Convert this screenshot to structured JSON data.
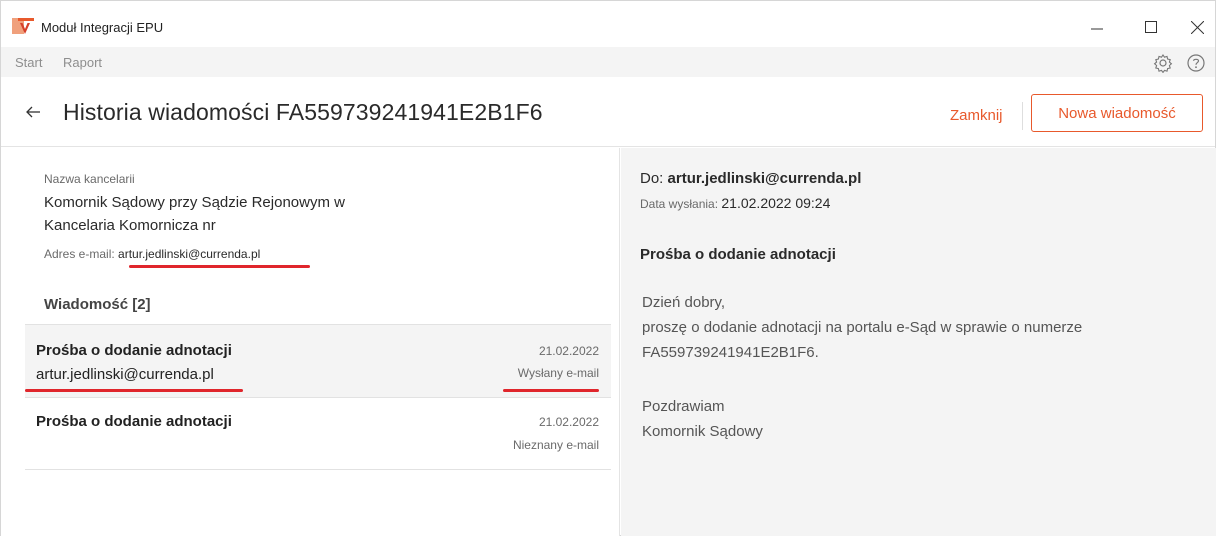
{
  "window": {
    "title": "Moduł Integracji EPU"
  },
  "menu": {
    "items": [
      "Start",
      "Raport"
    ],
    "icons": [
      "gear-icon",
      "help-icon"
    ]
  },
  "header": {
    "title": "Historia wiadomości FA559739241941E2B1F6",
    "close_label": "Zamknij",
    "new_message_label": "Nowa wiadomość"
  },
  "office": {
    "name_label": "Nazwa kancelarii",
    "name_line1": "Komornik Sądowy przy Sądzie Rejonowym w",
    "name_line2": "Kancelaria Komornicza nr",
    "email_label": "Adres e-mail:",
    "email": "artur.jedlinski@currenda.pl"
  },
  "messages": {
    "section_title": "Wiadomość [2]",
    "items": [
      {
        "subject": "Prośba o dodanie adnotacji",
        "from": "artur.jedlinski@currenda.pl",
        "date": "21.02.2022",
        "status": "Wysłany e-mail"
      },
      {
        "subject": "Prośba o dodanie adnotacji",
        "from": "",
        "date": "21.02.2022",
        "status": "Nieznany e-mail"
      }
    ]
  },
  "detail": {
    "to_label": "Do:",
    "to": "artur.jedlinski@currenda.pl",
    "sent_label": "Data wysłania:",
    "sent": "21.02.2022 09:24",
    "subject": "Prośba o dodanie adnotacji",
    "body": [
      "Dzień dobry,",
      "proszę o dodanie adnotacji na portalu e-Sąd w sprawie o numerze",
      "FA559739241941E2B1F6.",
      "",
      "Pozdrawiam",
      "Komornik Sądowy"
    ]
  },
  "colors": {
    "accent": "#e8592c",
    "highlight_underline": "#e0262c",
    "panel_bg": "#f4f4f4"
  }
}
